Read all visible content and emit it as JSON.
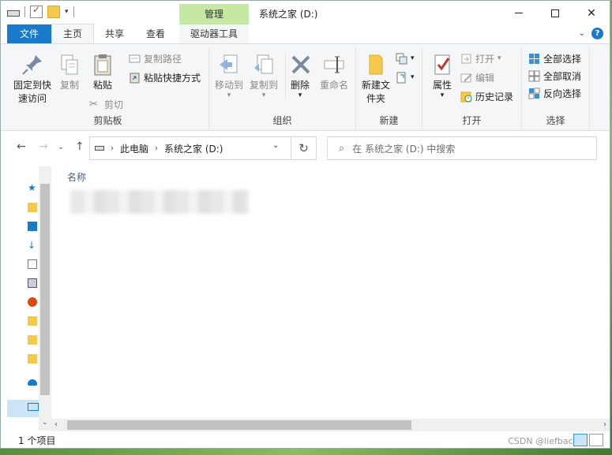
{
  "titlebar": {
    "context_tab": "管理",
    "title": "系统之家 (D:)"
  },
  "tabs": {
    "file": "文件",
    "home": "主页",
    "share": "共享",
    "view": "查看",
    "drive_tools": "驱动器工具"
  },
  "ribbon": {
    "clipboard": {
      "label": "剪贴板",
      "pin": "固定到快速访问",
      "copy": "复制",
      "paste": "粘贴",
      "copy_path": "复制路径",
      "paste_shortcut": "粘贴快捷方式",
      "cut": "剪切"
    },
    "organize": {
      "label": "组织",
      "move_to": "移动到",
      "copy_to": "复制到",
      "delete": "删除",
      "rename": "重命名"
    },
    "new": {
      "label": "新建",
      "new_folder": "新建文件夹"
    },
    "open": {
      "label": "打开",
      "properties": "属性",
      "open": "打开",
      "edit": "编辑",
      "history": "历史记录"
    },
    "select": {
      "label": "选择",
      "select_all": "全部选择",
      "select_none": "全部取消",
      "invert": "反向选择"
    }
  },
  "address": {
    "crumb_pc": "此电脑",
    "crumb_drive": "系统之家 (D:)",
    "search_placeholder": "在 系统之家 (D:) 中搜索"
  },
  "content": {
    "column_name": "名称"
  },
  "status": {
    "count": "1 个项目",
    "watermark": "CSDN @liefback"
  }
}
